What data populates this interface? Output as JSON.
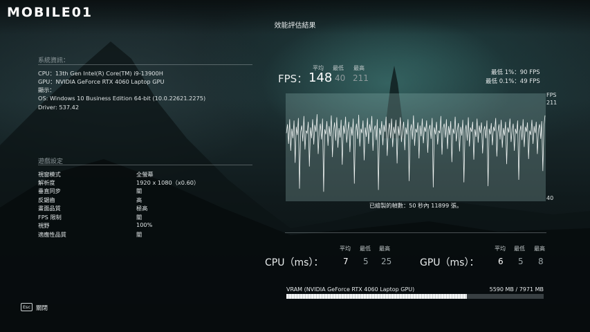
{
  "header": {
    "logo_text": "MOBILE01",
    "page_title": "效能評估結果"
  },
  "system_info": {
    "heading": "系統資訊：",
    "lines": [
      "CPU：13th Gen Intel(R) Core(TM) i9-13900H",
      "GPU：NVIDIA GeForce RTX 4060 Laptop GPU",
      "顯示：",
      "OS: Windows 10 Business Edition 64-bit (10.0.22621.2275)",
      "Driver: 537.42"
    ]
  },
  "game_settings": {
    "heading": "遊戲設定",
    "rows": [
      {
        "label": "視窗模式",
        "value": "全螢幕"
      },
      {
        "label": "解析度",
        "value": "1920 x 1080（x0.60）"
      },
      {
        "label": "垂直同步",
        "value": "關"
      },
      {
        "label": "反鋸齒",
        "value": "高"
      },
      {
        "label": "畫面品質",
        "value": "極高"
      },
      {
        "label": "FPS 限制",
        "value": "關"
      },
      {
        "label": "視野",
        "value": "100%"
      },
      {
        "label": "適應性品質",
        "value": "關"
      }
    ]
  },
  "fps": {
    "label": "FPS：",
    "avg_label": "平均",
    "min_label": "最低",
    "max_label": "最高",
    "avg": "148",
    "min": "40",
    "max": "211",
    "low_1_label": "最低 1%：",
    "low_1_value": "90 FPS",
    "low_01_label": "最低 0.1%：",
    "low_01_value": "49 FPS",
    "axis_unit": "FPS",
    "axis_top": "211",
    "axis_bottom": "40",
    "frames_text": "已繪製的幀數：50 秒內 11899 張。"
  },
  "cpu": {
    "title": "CPU（ms）：",
    "avg_label": "平均",
    "min_label": "最低",
    "max_label": "最高",
    "avg": "7",
    "min": "5",
    "max": "25"
  },
  "gpu": {
    "title": "GPU（ms）：",
    "avg_label": "平均",
    "min_label": "最低",
    "max_label": "最高",
    "avg": "6",
    "min": "5",
    "max": "8"
  },
  "vram": {
    "label": "VRAM (NVIDIA GeForce RTX 4060 Laptop GPU)",
    "value": "5590 MB / 7971 MB",
    "used_mb": 5590,
    "total_mb": 7971
  },
  "footer": {
    "esc_key": "Esc",
    "close_label": "關閉"
  },
  "chart_data": {
    "type": "line",
    "ylim": [
      40,
      211
    ],
    "series": [
      {
        "values": [
          148,
          162,
          131,
          170,
          120,
          155,
          140,
          168,
          101,
          158,
          145,
          172,
          60,
          150,
          160,
          135,
          175,
          122,
          152,
          148,
          166,
          95,
          157,
          140,
          170,
          130,
          161,
          150,
          178,
          115,
          149,
          163,
          138,
          171,
          55,
          154,
          146,
          167,
          128,
          159,
          143,
          176,
          110,
          151,
          165,
          136,
          173,
          125,
          156,
          141,
          169,
          98,
          160,
          147,
          174,
          133,
          152,
          166,
          118,
          158,
          144,
          171,
          68,
          150,
          163,
          139,
          177,
          127,
          155,
          148,
          168,
          105,
          157,
          142,
          172,
          131,
          162,
          149,
          175,
          120,
          153,
          160,
          137,
          170,
          58,
          156,
          145,
          167,
          129,
          161,
          150,
          174,
          112,
          152,
          164,
          140,
          171,
          126,
          158,
          147,
          169,
          100,
          159,
          144,
          173,
          134,
          154,
          166,
          121,
          157,
          146,
          170,
          72,
          151,
          162,
          138,
          176,
          128,
          155,
          149,
          165,
          108,
          160,
          143,
          171,
          132,
          158,
          150,
          168,
          117,
          154,
          161,
          139,
          172,
          62,
          157,
          146,
          166,
          130,
          152,
          148,
          175,
          114,
          156,
          163,
          141,
          170,
          123,
          159,
          145,
          167,
          102,
          155,
          147,
          174,
          135,
          153,
          164,
          119,
          158,
          144,
          169,
          70,
          150,
          161,
          136,
          173,
          127,
          157,
          150,
          166,
          106,
          154,
          142,
          171,
          133,
          160,
          148,
          165,
          116,
          152,
          159,
          140,
          168,
          64,
          155,
          146,
          164,
          129,
          158,
          151,
          172,
          111,
          150,
          162,
          138,
          169,
          125,
          156,
          144,
          166,
          99,
          157,
          149,
          171,
          134,
          153,
          163,
          120,
          155,
          147,
          168,
          74,
          151,
          160,
          137,
          170,
          126,
          158,
          150,
          165,
          107,
          152,
          145,
          169,
          131,
          159,
          148,
          166,
          115,
          154,
          162,
          139,
          167,
          88,
          160,
          176
        ]
      }
    ]
  }
}
